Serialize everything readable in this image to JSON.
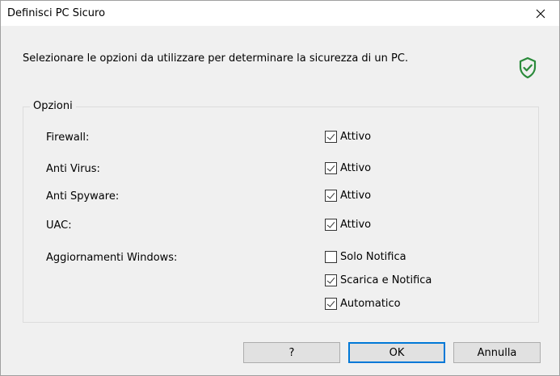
{
  "window": {
    "title": "Definisci PC Sicuro",
    "close": "✕"
  },
  "intro": "Selezionare le opzioni da utilizzare per determinare la sicurezza di un PC.",
  "icons": {
    "shield": "shield-check-icon",
    "accent": "#2a8a3a"
  },
  "group": {
    "legend": "Opzioni",
    "rows": [
      {
        "label": "Firewall:",
        "option": "Attivo",
        "checked": true
      },
      {
        "label": "Anti Virus:",
        "option": "Attivo",
        "checked": true
      },
      {
        "label": "Anti Spyware:",
        "option": "Attivo",
        "checked": true
      },
      {
        "label": "UAC:",
        "option": "Attivo",
        "checked": true
      },
      {
        "label": "Aggiornamenti Windows:",
        "option": "Solo Notifica",
        "checked": false
      },
      {
        "label": "",
        "option": "Scarica e Notifica",
        "checked": true
      },
      {
        "label": "",
        "option": "Automatico",
        "checked": true
      }
    ]
  },
  "buttons": {
    "help": "?",
    "ok": "OK",
    "cancel": "Annulla"
  }
}
